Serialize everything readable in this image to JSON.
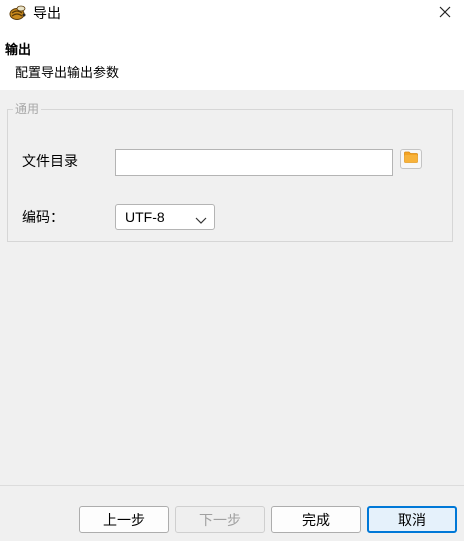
{
  "window": {
    "title": "导出",
    "app_icon": "app-logo-icon",
    "close_icon": "close-icon"
  },
  "header": {
    "title": "输出",
    "description": "配置导出输出参数"
  },
  "group": {
    "legend": "通用",
    "directory": {
      "label": "文件目录",
      "value": "",
      "placeholder": "",
      "browse_icon": "folder-icon"
    },
    "encoding": {
      "label": "编码：",
      "selected": "UTF-8",
      "dropdown_icon": "chevron-down-icon"
    }
  },
  "footer": {
    "prev_label": "上一步",
    "next_label": "下一步",
    "finish_label": "完成",
    "cancel_label": "取消"
  },
  "colors": {
    "dialog_bg": "#f0f0f0",
    "primary_border": "#0078d7",
    "folder": "#f4a323"
  }
}
